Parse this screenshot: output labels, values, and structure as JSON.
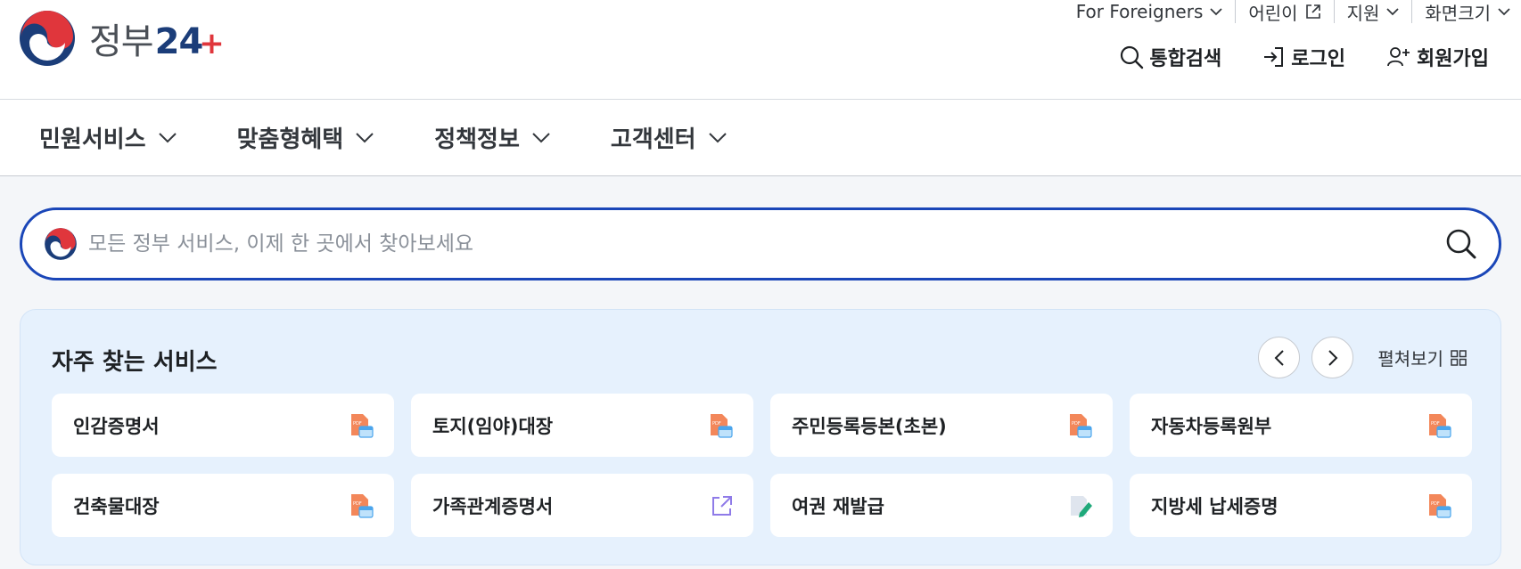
{
  "header": {
    "logo_text": "정부",
    "logo_number": "24",
    "logo_plus": "+",
    "util": [
      {
        "label": "For Foreigners",
        "icon": "chevron-down-icon"
      },
      {
        "label": "어린이",
        "icon": "external-link-icon"
      },
      {
        "label": "지원",
        "icon": "chevron-down-icon"
      },
      {
        "label": "화면크기",
        "icon": "chevron-down-icon"
      }
    ],
    "account": [
      {
        "label": "통합검색",
        "icon": "search-icon"
      },
      {
        "label": "로그인",
        "icon": "login-icon"
      },
      {
        "label": "회원가입",
        "icon": "user-plus-icon"
      }
    ]
  },
  "nav": {
    "items": [
      {
        "label": "민원서비스"
      },
      {
        "label": "맞춤형혜택"
      },
      {
        "label": "정책정보"
      },
      {
        "label": "고객센터"
      }
    ]
  },
  "search": {
    "placeholder": "모든 정부 서비스, 이제 한 곳에서 찾아보세요",
    "value": ""
  },
  "frequent": {
    "title": "자주 찾는 서비스",
    "expand_label": "펼쳐보기",
    "items": [
      {
        "label": "인감증명서",
        "icon": "pdf-document-icon"
      },
      {
        "label": "토지(임야)대장",
        "icon": "pdf-document-icon"
      },
      {
        "label": "주민등록등본(초본)",
        "icon": "pdf-document-icon"
      },
      {
        "label": "자동차등록원부",
        "icon": "pdf-document-icon"
      },
      {
        "label": "건축물대장",
        "icon": "pdf-document-icon"
      },
      {
        "label": "가족관계증명서",
        "icon": "external-link-icon"
      },
      {
        "label": "여권 재발급",
        "icon": "edit-document-icon"
      },
      {
        "label": "지방세 납세증명",
        "icon": "pdf-document-icon"
      }
    ]
  },
  "colors": {
    "accent": "#1a46b8",
    "logo_navy": "#1b3d79",
    "logo_red": "#e0363c",
    "panel_bg": "#e6f1fd"
  }
}
